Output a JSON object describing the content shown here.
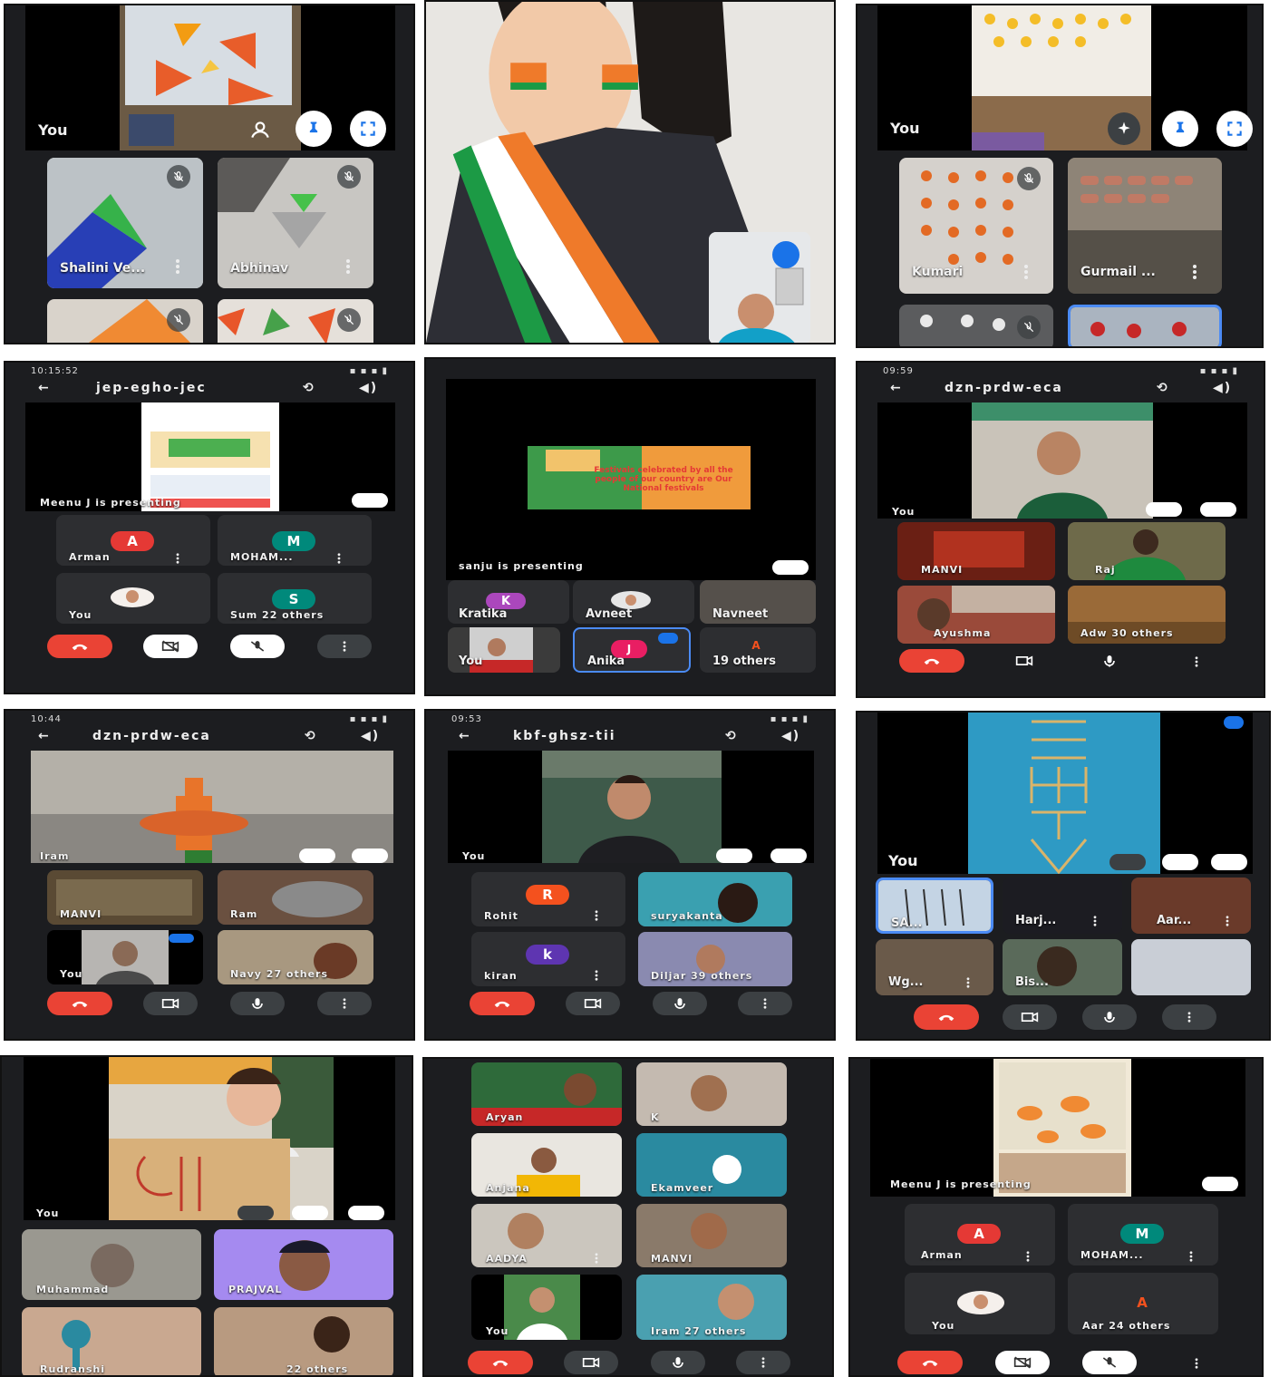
{
  "panels": {
    "p1": {
      "self_label": "You",
      "tiles": [
        "Shalini Ve...",
        "Abhinav"
      ]
    },
    "p3": {
      "self_label": "You",
      "tiles": [
        "Kumari",
        "Gurmail ..."
      ]
    },
    "p4": {
      "status_time": "10:15:52",
      "meeting_code": "jep-egho-jec",
      "presenting_label": "Meenu J is presenting",
      "tiles": [
        {
          "initial": "A",
          "name": "Arman"
        },
        {
          "initial": "M",
          "name": "MOHAM..."
        },
        {
          "initial": "",
          "name": "You"
        },
        {
          "initial": "S",
          "name": "Sum  22 others"
        }
      ]
    },
    "p5": {
      "slide_text": "Festivals celebrated by all the people of our country are Our National festivals",
      "presenting_label": "sanju is presenting",
      "tiles": [
        {
          "initial": "K",
          "name": "Kratika"
        },
        {
          "initial": "",
          "name": "Avneet"
        },
        {
          "initial": "",
          "name": "Navneet"
        },
        {
          "initial": "",
          "name": "You"
        },
        {
          "initial": "J",
          "name": "Anika"
        },
        {
          "initial": "A",
          "name": "19 others"
        }
      ]
    },
    "p6": {
      "status_time": "09:59",
      "meeting_code": "dzn-prdw-eca",
      "self_label": "You",
      "tiles": [
        "MANVI",
        "Raj",
        "Ayushma",
        "Adw  30 others"
      ]
    },
    "p7": {
      "status_time": "10:44",
      "meeting_code": "dzn-prdw-eca",
      "stage_label": "Iram",
      "tiles": [
        "MANVI",
        "Ram",
        "You",
        "Navy  27 others"
      ]
    },
    "p8": {
      "status_time": "09:53",
      "meeting_code": "kbf-ghsz-tii",
      "self_label": "You",
      "tiles": [
        {
          "initial": "R",
          "name": "Rohit"
        },
        {
          "initial": "",
          "name": "suryakanta"
        },
        {
          "initial": "k",
          "name": "kiran"
        },
        {
          "initial": "",
          "name": "Diljar  39 others"
        }
      ]
    },
    "p9": {
      "self_label": "You",
      "tiles": [
        "SA...",
        "Harj...",
        "Aar...",
        "Wg...",
        "Bis..."
      ]
    },
    "p10": {
      "self_label": "You",
      "tiles": [
        "Muhammad",
        "PRAJVAL",
        "Rudranshi",
        "  22 others"
      ]
    },
    "p11": {
      "tiles": [
        "Aryan",
        "K",
        "Anjana",
        "Ekamveer",
        "AADYA",
        "MANVI",
        "You",
        "Iram  27 others"
      ]
    },
    "p12": {
      "presenting_label": "Meenu J is presenting",
      "tiles": [
        {
          "initial": "A",
          "name": "Arman"
        },
        {
          "initial": "M",
          "name": "MOHAM..."
        },
        {
          "initial": "",
          "name": "You"
        },
        {
          "initial": "A",
          "name": "Aar  24 others"
        }
      ]
    }
  },
  "colors": {
    "hangup": "#ea4335",
    "accent": "#1a73e8",
    "avatar_red": "#e53935",
    "avatar_teal": "#00897b",
    "avatar_purple": "#7e57c2",
    "avatar_pink": "#e91e63"
  }
}
